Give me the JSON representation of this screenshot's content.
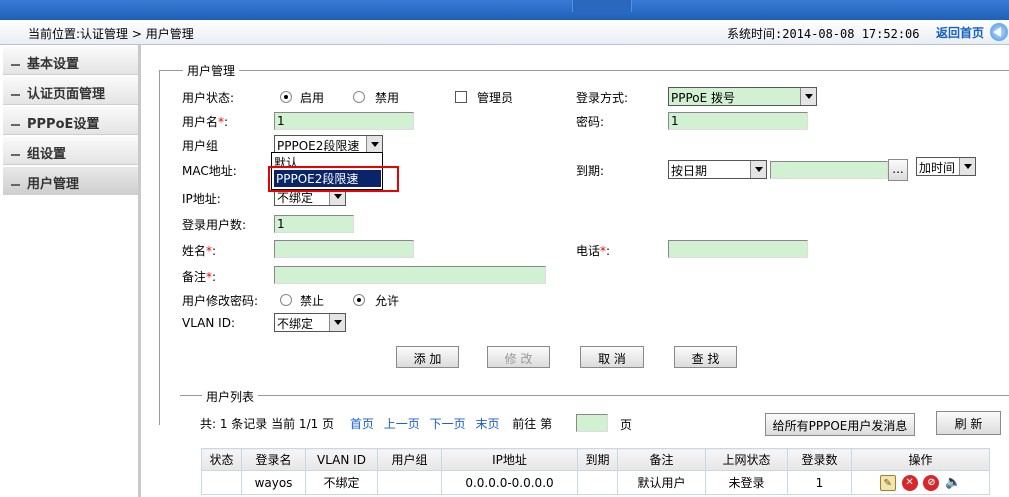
{
  "header": {
    "location": "当前位置:认证管理 > 用户管理",
    "system_time": "系统时间:2014-08-08 17:52:06",
    "home_link": "返回首页"
  },
  "sidebar": {
    "items": [
      {
        "label": "基本设置"
      },
      {
        "label": "认证页面管理"
      },
      {
        "label": "PPPoE设置"
      },
      {
        "label": "组设置"
      },
      {
        "label": "用户管理"
      }
    ]
  },
  "form": {
    "legend": "用户管理",
    "status_label": "用户状态:",
    "status_enable": "启用",
    "status_disable": "禁用",
    "admin_label": "管理员",
    "login_method_label": "登录方式:",
    "login_method_value": "PPPoE 拨号",
    "username_label": "用户名",
    "username_value": "1",
    "password_label": "密码:",
    "password_value": "1",
    "group_label": "用户组",
    "group_value": "PPPOE2段限速",
    "group_options": [
      "默认",
      "PPPOE2段限速"
    ],
    "mac_label": "MAC地址:",
    "expire_label": "到期:",
    "expire_mode_value": "按日期",
    "expire_date_value": "",
    "browse_label": "...",
    "add_time_value": "加时间",
    "ip_label": "IP地址:",
    "ip_value": "不绑定",
    "login_count_label": "登录用户数:",
    "login_count_value": "1",
    "name_label": "姓名",
    "name_value": "",
    "phone_label": "电话",
    "phone_value": "",
    "remark_label": "备注",
    "remark_value": "",
    "change_pwd_label": "用户修改密码:",
    "change_pwd_forbid": "禁止",
    "change_pwd_allow": "允许",
    "vlan_label": "VLAN ID:",
    "vlan_value": "不绑定",
    "required_mark": "*",
    "buttons": {
      "add": "添  加",
      "modify": "修  改",
      "cancel": "取  消",
      "search": "查 找"
    }
  },
  "list": {
    "legend": "用户列表",
    "total_prefix": "共: 1 条记录 当前 1/1 页",
    "first": "首页",
    "prev": "上一页",
    "next": "下一页",
    "last": "末页",
    "goto_prefix": "前往 第",
    "goto_value": "",
    "goto_suffix": "页",
    "send_msg_button": "给所有PPPOE用户发消息",
    "refresh_button": "刷  新",
    "columns": [
      "状态",
      "登录名",
      "VLAN ID",
      "用户组",
      "IP地址",
      "到期",
      "备注",
      "上网状态",
      "登录数",
      "操作"
    ],
    "rows": [
      {
        "status": "",
        "login": "wayos",
        "vlan": "不绑定",
        "group": "",
        "ip": "0.0.0.0-0.0.0.0",
        "expire": "",
        "remark": "默认用户",
        "online": "未登录",
        "count": "1"
      }
    ]
  }
}
